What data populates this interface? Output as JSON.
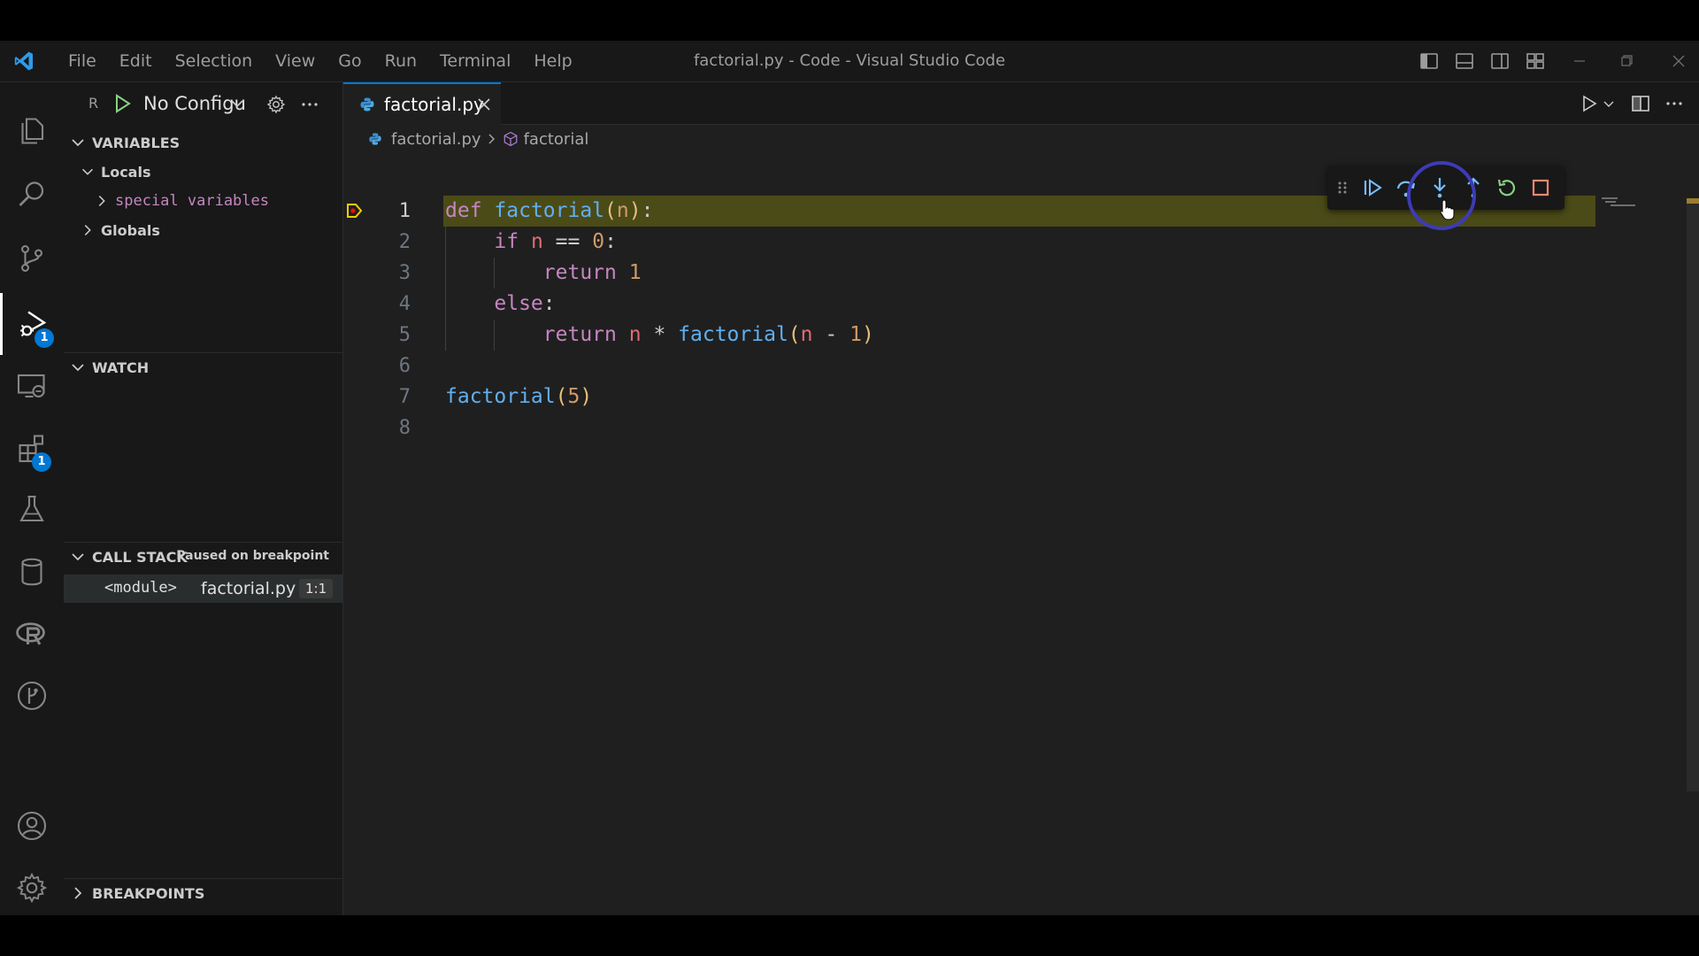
{
  "window": {
    "title": "factorial.py - Code - Visual Studio Code"
  },
  "menu": [
    "File",
    "Edit",
    "Selection",
    "View",
    "Go",
    "Run",
    "Terminal",
    "Help"
  ],
  "activity": {
    "run_debug_badge": "1",
    "extensions_badge": "1"
  },
  "sidebar": {
    "run_label": "R",
    "config": "No Configu",
    "variables_title": "VARIABLES",
    "locals": "Locals",
    "special_variables": "special variables",
    "globals": "Globals",
    "watch_title": "WATCH",
    "callstack_title": "CALL STACK",
    "callstack_status": "Paused on breakpoint",
    "frame": {
      "name": "<module>",
      "file": "factorial.py",
      "position": "1:1"
    },
    "breakpoints_title": "BREAKPOINTS"
  },
  "editor": {
    "tab_label": "factorial.py",
    "breadcrumb": [
      "factorial.py",
      "factorial"
    ],
    "current_line": 1,
    "lines": [
      {
        "n": "1"
      },
      {
        "n": "2"
      },
      {
        "n": "3"
      },
      {
        "n": "4"
      },
      {
        "n": "5"
      },
      {
        "n": "6"
      },
      {
        "n": "7"
      },
      {
        "n": "8"
      }
    ],
    "code": {
      "l1": {
        "kw": "def",
        "fn": "factorial",
        "open": "(",
        "param": "n",
        "close": ")",
        "colon": ":"
      },
      "l2": {
        "kw": "if",
        "var": "n",
        "op": "==",
        "num": "0",
        "colon": ":"
      },
      "l3": {
        "kw": "return",
        "num": "1"
      },
      "l4": {
        "kw": "else",
        "colon": ":"
      },
      "l5": {
        "kw": "return",
        "var": "n",
        "op": "*",
        "fn": "factorial",
        "open": "(",
        "var2": "n",
        "minus": "-",
        "num": "1",
        "close": ")"
      },
      "l7": {
        "fn": "factorial",
        "open": "(",
        "num": "5",
        "close": ")"
      }
    }
  },
  "colors": {
    "accent": "#0078d4",
    "current_line_highlight": "#4b4b18",
    "breakpoint_arrow": "#ffcc00",
    "continue": "#75beff",
    "restart": "#89d185",
    "stop": "#f48771",
    "click_ring": "#3d3bb8"
  },
  "icons": {
    "activity": [
      "explorer-icon",
      "search-icon",
      "source-control-icon",
      "run-debug-icon",
      "remote-explorer-icon",
      "extensions-icon",
      "testing-icon",
      "database-icon",
      "r-icon",
      "git-graph-icon",
      "account-icon",
      "settings-gear-icon"
    ],
    "debug_toolbar": [
      "drag-handle-icon",
      "continue-icon",
      "step-over-icon",
      "step-into-icon",
      "step-out-icon",
      "restart-icon",
      "stop-icon"
    ]
  }
}
